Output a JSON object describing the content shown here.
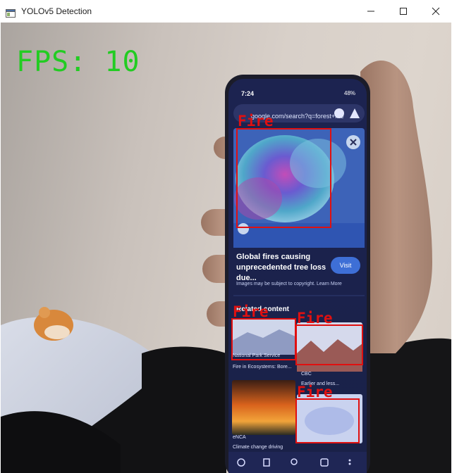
{
  "window": {
    "title": "YOLOv5 Detection",
    "controls": [
      "minimize",
      "maximize",
      "close"
    ]
  },
  "overlay": {
    "fps_text": "FPS: 10",
    "fps_color": "#22cc22",
    "box_color": "#e01010"
  },
  "detections": [
    {
      "label": "Fire"
    },
    {
      "label": "Fire"
    },
    {
      "label": "Fire"
    },
    {
      "label": "Fire"
    }
  ],
  "phone_screen": {
    "status_time": "7:24",
    "battery": "48%",
    "url": "google.com/search?q=forest+fire",
    "headline": "Global fires causing unprecedented tree loss due...",
    "copyright_note": "Images may be subject to copyright. Learn More",
    "visit_button": "Visit",
    "related_heading": "Related content",
    "tiles": [
      {
        "source": "National Park Service",
        "caption": "Fire in Ecosystems: Bore..."
      },
      {
        "source": "CBC",
        "caption": "Earlier and less..."
      },
      {
        "source": "eNCA",
        "caption": "Climate change driving"
      }
    ]
  }
}
